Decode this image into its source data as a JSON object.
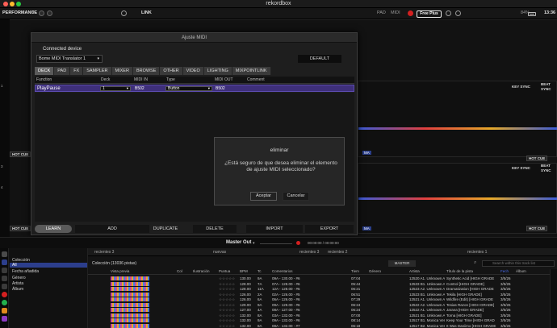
{
  "app": {
    "title": "rekordbox",
    "mode": "PERFORMANCE",
    "link": "LINK",
    "pad": "PAD",
    "midi": "MIDI",
    "plan": "Free Plus",
    "battery": "84%",
    "clock": "13:36"
  },
  "left_strip": {
    "r1": "1",
    "r2": "3",
    "r4": "4"
  },
  "deck": {
    "hot_cue": "HOT CUE",
    "key_sync": "KEY SYNC",
    "beat": "BEAT",
    "sync": "SYNC",
    "ma": "MA"
  },
  "midi_dialog": {
    "title": "Ajuste MIDI",
    "connected_label": "Connected device",
    "device": "Bome MIDI Translator 1",
    "default_btn": "DEFAULT",
    "tabs": [
      "DECK",
      "PAD",
      "FX",
      "SAMPLER",
      "MIXER",
      "BROWSE",
      "OTHER",
      "VIDEO",
      "LIGHTING",
      "MIXPOINTLINK"
    ],
    "columns": [
      "Function",
      "Deck",
      "MIDI IN",
      "Type",
      "MIDI OUT",
      "Comment"
    ],
    "row": {
      "function": "PlayPause",
      "deck": "1",
      "midi_in": "B502",
      "type": "Button",
      "midi_out": "B502",
      "comment": ""
    },
    "buttons": {
      "learn": "LEARN",
      "add": "ADD",
      "duplicate": "DUPLICATE",
      "delete": "DELETE",
      "import": "IMPORT",
      "export": "EXPORT"
    }
  },
  "confirm": {
    "title": "eliminar",
    "message": "¿Está seguro de que desea eliminar el elemento de ajuste MIDI seleccionado?",
    "accept": "Aceptar",
    "cancel": "Cancelar"
  },
  "master": {
    "label": "Master Out",
    "time": "00:00:00 / 00:00:00"
  },
  "browser": {
    "tree": [
      "Colección",
      "All",
      "Fecha añadida",
      "Género",
      "Artista",
      "Álbum"
    ],
    "tabs": [
      "recientes 3",
      "nuevas",
      "recientes 3",
      "recientes 2",
      "recientes 1"
    ],
    "collection_title": "Colección (13036 pistas)",
    "master_pill": "MASTER",
    "search_placeholder": "Search within this track list",
    "columns": [
      "Vista previa",
      "Col",
      "Ilustración",
      "Puntua",
      "BPM",
      "Tc",
      "Comentarios",
      "Tiem",
      "Género",
      "Artista",
      "Título de la pista",
      "Fech",
      "Álbum"
    ],
    "rows": [
      [
        "130.00",
        "9A",
        "09A - 130.00 - #6",
        "07:04",
        "12520 A1. Unknown Art",
        "Synthetic Acid [HIGH GRADE",
        "3/5/26"
      ],
      [
        "128.00",
        "7A",
        "07A - 128.00 - #6",
        "05:44",
        "12533 B1. Unknown Art",
        "Control [HIGH GRADE]",
        "3/5/26"
      ],
      [
        "128.00",
        "11A",
        "12A - 128.00 - #6",
        "06:21",
        "12523 A2. Unknown Art",
        "Dramatization [HIGH GRADE",
        "3/5/26"
      ],
      [
        "126.00",
        "2A",
        "02A - 126.00 - #5",
        "06:51",
        "12523 B1. Unknown Art",
        "Tekila [HIGH GRADE]",
        "3/5/26"
      ],
      [
        "126.00",
        "6A",
        "06A - 126.00 - #6",
        "07:29",
        "12521 A1. Unknown Art",
        "Wildfire (Edit) [HIGH GRADE",
        "3/5/26"
      ],
      [
        "129.00",
        "9A",
        "09A - 129.00 - #6",
        "06:24",
        "12522 A2. Unknown Art",
        "Tesias Razon [HIGH GRADE]",
        "3/5/26"
      ],
      [
        "127.00",
        "4A",
        "08A - 127.00 - #6",
        "06:24",
        "12522 A1. Unknown Art",
        "Jarana [HIGH GRADE]",
        "3/5/26"
      ],
      [
        "132.00",
        "8A",
        "03A - 132.00 - #6",
        "07:00",
        "12521 B1. Unknown Art",
        "Torna [HIGH GRADE]",
        "3/5/26"
      ],
      [
        "132.00",
        "9A",
        "09A - 132.00 - #6",
        "08:14",
        "12517 B1. Monica Vert",
        "Keep Your Time [HIGH GRAD",
        "3/5/26"
      ],
      [
        "132.00",
        "8A",
        "08A - 132.00 - #7",
        "06:18",
        "12517 B2. Monica Vert",
        "It Was Daniimo [HIGH GRADE",
        "3/5/26"
      ]
    ]
  },
  "colors": {
    "accent_purple": "#3e2f7a",
    "selection_blue": "#2c3e8c",
    "record_red": "#d32020"
  }
}
